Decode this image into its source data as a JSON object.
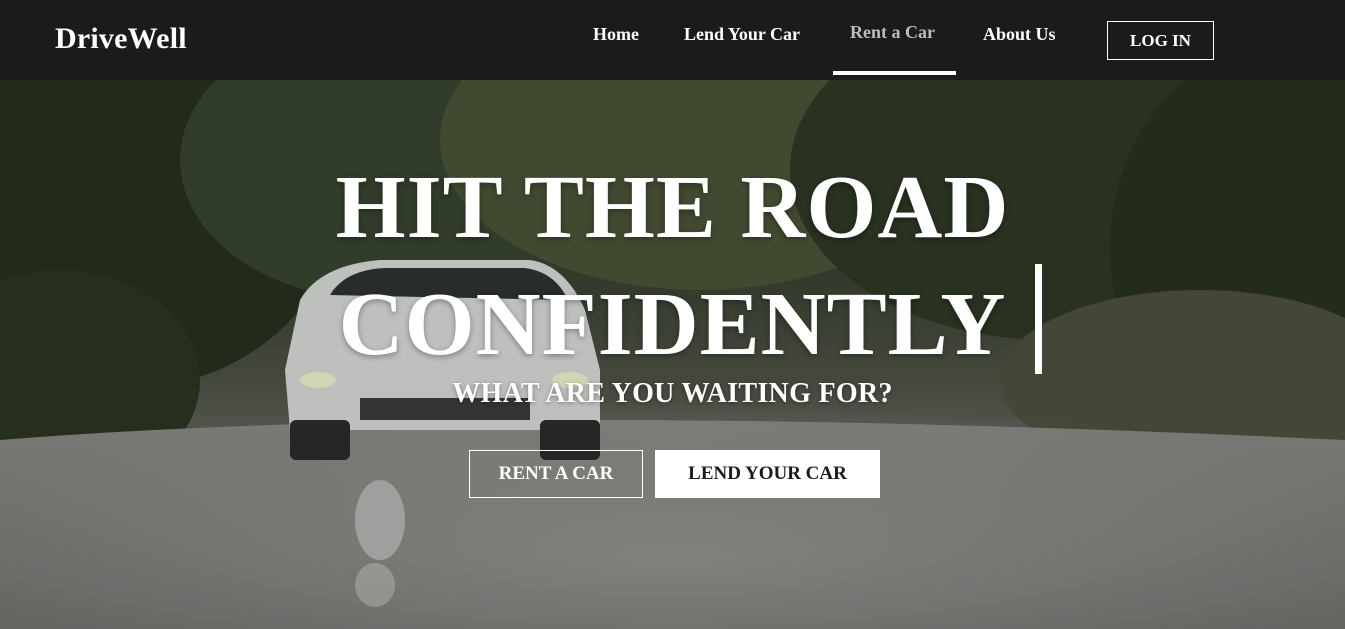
{
  "navbar": {
    "brand": "DriveWell",
    "links": [
      {
        "label": "Home"
      },
      {
        "label": "Lend Your Car"
      },
      {
        "label": "Rent a Car"
      },
      {
        "label": "About Us"
      }
    ],
    "active_link": "Rent a Car",
    "login_label": "LOG IN"
  },
  "hero": {
    "headline_line1": "HIT THE ROAD",
    "headline_line2": "CONFIDENTLY",
    "subheadline": "WHAT ARE YOU WAITING FOR?",
    "rent_button": "RENT A CAR",
    "lend_button": "LEND YOUR CAR",
    "background_description_icon": "white-suv-on-wet-road-image"
  },
  "colors": {
    "navbar_bg": "#1c1b1b",
    "text": "#ffffff",
    "active_link": "#bdbdbd"
  }
}
